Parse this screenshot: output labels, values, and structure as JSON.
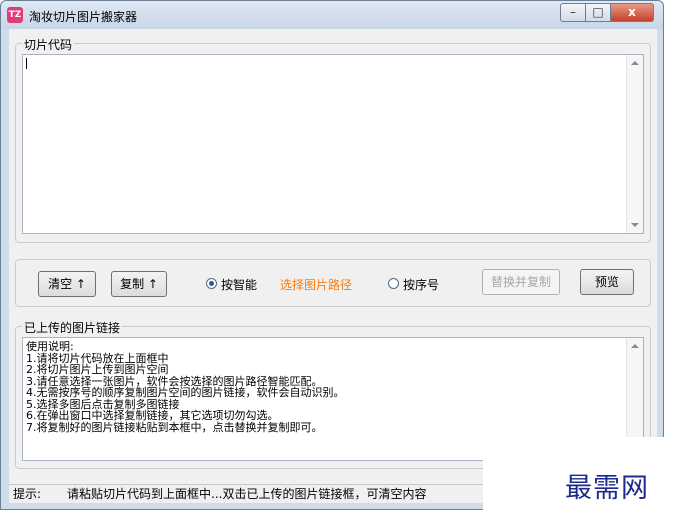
{
  "window": {
    "title": "淘妆切片图片搬家器",
    "icon_text": "TZ",
    "controls": {
      "minimize": "–",
      "maximize": "□",
      "close": "x"
    }
  },
  "code_group": {
    "legend": "切片代码",
    "value": ""
  },
  "toolbar": {
    "clear_label": "清空 ↑",
    "copy_label": "复制 ↑",
    "smart_radio": "按智能",
    "choose_path": "选择图片路径",
    "order_radio": "按序号",
    "replace_label": "替换并复制",
    "preview_label": "预览",
    "selected_mode": "按智能"
  },
  "links_group": {
    "legend": "已上传的图片链接",
    "lines": [
      "使用说明:",
      "1.请将切片代码放在上面框中",
      "2.将切片图片上传到图片空间",
      "3.请任意选择一张图片，软件会按选择的图片路径智能匹配。",
      "4.无需按序号的顺序复制图片空间的图片链接，软件会自动识别。",
      "5.选择多图后点击复制多图链接",
      "6.在弹出窗口中选择复制链接，其它选项切勿勾选。",
      "7.将复制好的图片链接粘贴到本框中，点击替换并复制即可。"
    ]
  },
  "status": {
    "prefix": "提示:",
    "message": "请粘贴切片代码到上面框中...双击已上传的图片链接框，可清空内容"
  },
  "watermark": "最需网",
  "colors": {
    "accent": "#ff7a00",
    "watermark": "#1c2a8c",
    "close": "#c4412b"
  }
}
